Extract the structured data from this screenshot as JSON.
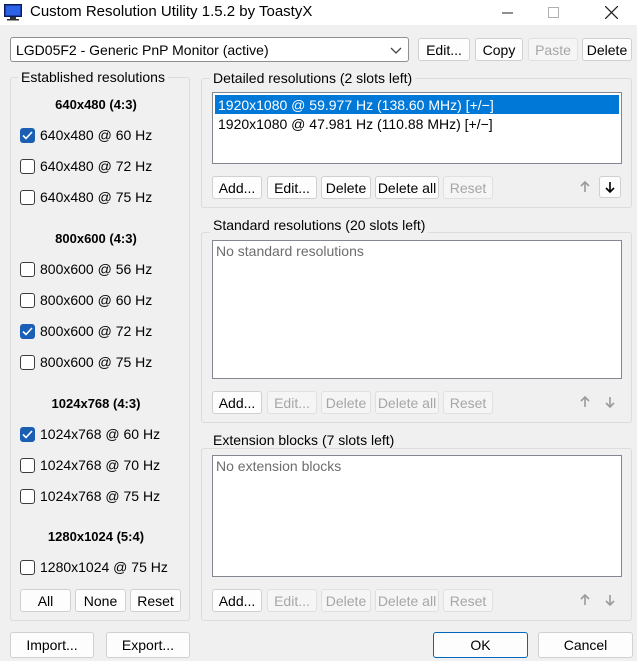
{
  "window": {
    "title": "Custom Resolution Utility 1.5.2 by ToastyX",
    "icon": "monitor-icon",
    "accent": "#0067c0"
  },
  "monitor": {
    "selected": "LGD05F2 - Generic PnP Monitor (active)",
    "buttons": {
      "edit": "Edit...",
      "copy": "Copy",
      "paste": "Paste",
      "delete": "Delete"
    }
  },
  "established": {
    "label": "Established resolutions",
    "groups": [
      {
        "header": "640x480 (4:3)",
        "items": [
          {
            "label": "640x480 @ 60 Hz",
            "checked": true
          },
          {
            "label": "640x480 @ 72 Hz",
            "checked": false
          },
          {
            "label": "640x480 @ 75 Hz",
            "checked": false
          }
        ]
      },
      {
        "header": "800x600 (4:3)",
        "items": [
          {
            "label": "800x600 @ 56 Hz",
            "checked": false
          },
          {
            "label": "800x600 @ 60 Hz",
            "checked": false
          },
          {
            "label": "800x600 @ 72 Hz",
            "checked": true
          },
          {
            "label": "800x600 @ 75 Hz",
            "checked": false
          }
        ]
      },
      {
        "header": "1024x768 (4:3)",
        "items": [
          {
            "label": "1024x768 @ 60 Hz",
            "checked": true
          },
          {
            "label": "1024x768 @ 70 Hz",
            "checked": false
          },
          {
            "label": "1024x768 @ 75 Hz",
            "checked": false
          }
        ]
      },
      {
        "header": "1280x1024 (5:4)",
        "items": [
          {
            "label": "1280x1024 @ 75 Hz",
            "checked": false
          }
        ]
      }
    ],
    "buttons": {
      "all": "All",
      "none": "None",
      "reset": "Reset"
    }
  },
  "detailed": {
    "label": "Detailed resolutions (2 slots left)",
    "items": [
      "1920x1080 @ 59.977 Hz (138.60 MHz) [+/−]",
      "1920x1080 @ 47.981 Hz (110.88 MHz) [+/−]"
    ]
  },
  "standard": {
    "label": "Standard resolutions (20 slots left)",
    "empty": "No standard resolutions"
  },
  "extension": {
    "label": "Extension blocks (7 slots left)",
    "empty": "No extension blocks"
  },
  "section_buttons": {
    "add": "Add...",
    "edit": "Edit...",
    "delete": "Delete",
    "delete_all": "Delete all",
    "reset": "Reset"
  },
  "footer": {
    "import": "Import...",
    "export": "Export...",
    "ok": "OK",
    "cancel": "Cancel"
  }
}
